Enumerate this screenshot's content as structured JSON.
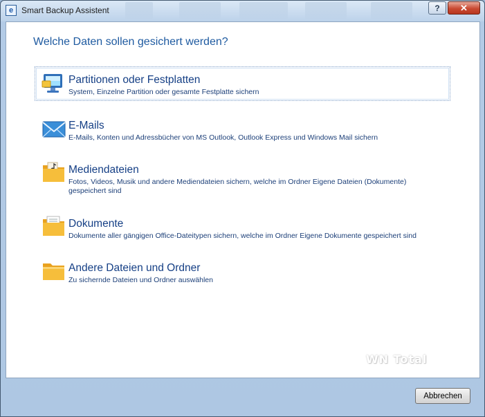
{
  "window": {
    "title": "Smart Backup Assistent",
    "help_label": "?",
    "close_label": "✕"
  },
  "heading": "Welche Daten sollen gesichert werden?",
  "options": [
    {
      "title": "Partitionen oder Festplatten",
      "description": "System, Einzelne Partition oder gesamte Festplatte sichern",
      "icon": "computer-icon"
    },
    {
      "title": "E-Mails",
      "description": "E-Mails, Konten und Adressbücher von MS Outlook, Outlook Express und Windows Mail sichern",
      "icon": "envelope-icon"
    },
    {
      "title": "Mediendateien",
      "description": "Fotos, Videos, Musik und andere Mediendateien sichern, welche im Ordner Eigene Dateien (Dokumente) gespeichert sind",
      "icon": "media-folder-icon"
    },
    {
      "title": "Dokumente",
      "description": "Dokumente aller gängigen Office-Dateitypen sichern, welche im Ordner Eigene Dokumente gespeichert sind",
      "icon": "documents-folder-icon"
    },
    {
      "title": "Andere Dateien und Ordner",
      "description": "Zu sichernde Dateien und Ordner auswählen",
      "icon": "folder-icon"
    }
  ],
  "watermark": "WN Total",
  "buttons": {
    "cancel": "Abbrechen"
  }
}
